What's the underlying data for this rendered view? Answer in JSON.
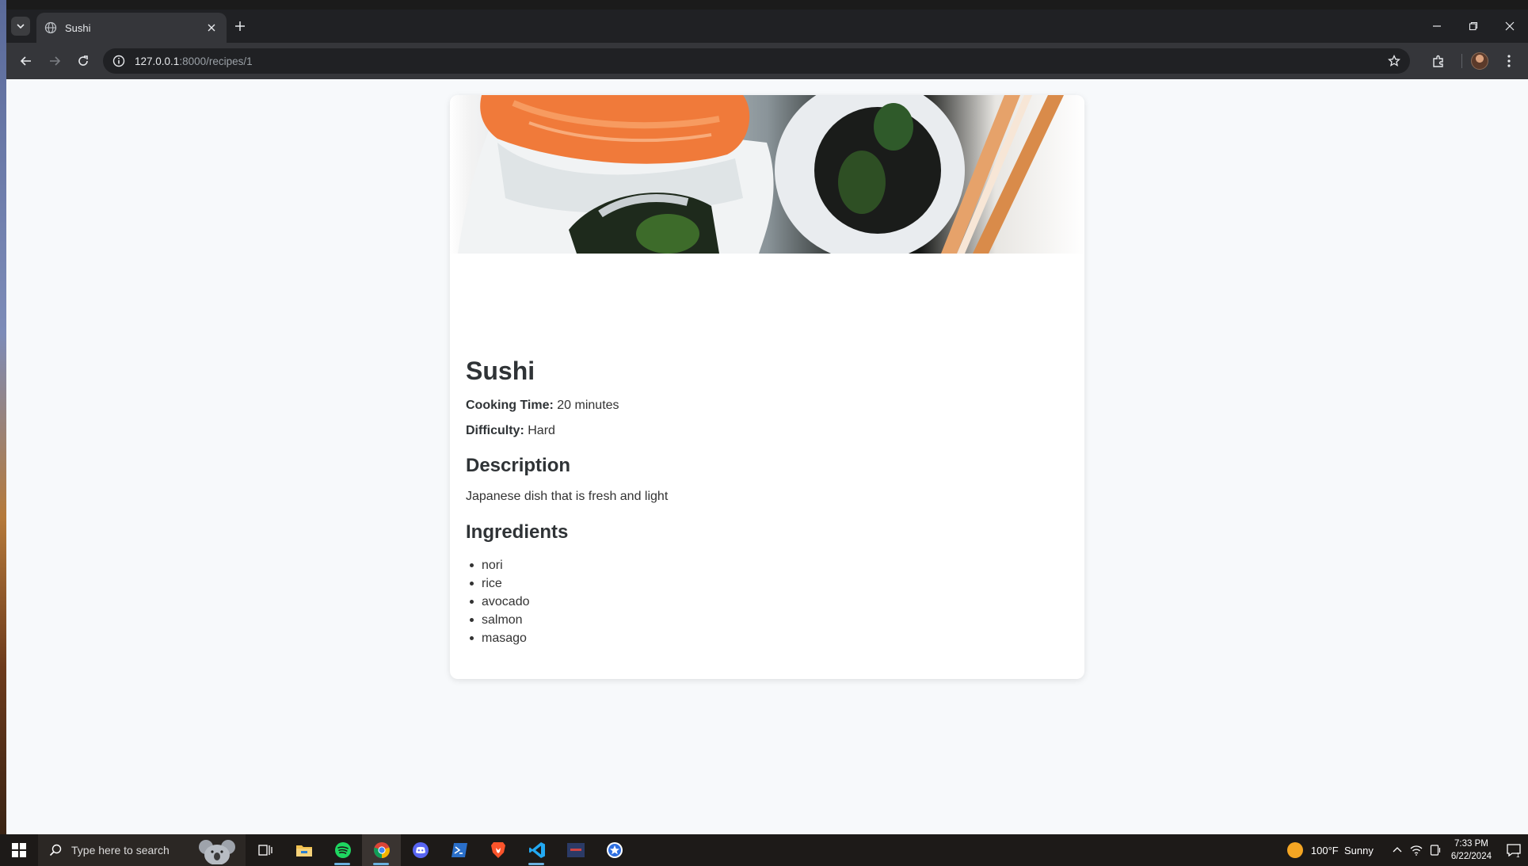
{
  "browser": {
    "tab_title": "Sushi",
    "url_host": "127.0.0.1",
    "url_rest": ":8000/recipes/1"
  },
  "recipe": {
    "title": "Sushi",
    "cooking_time_label": "Cooking Time:",
    "cooking_time_value": "20 minutes",
    "difficulty_label": "Difficulty:",
    "difficulty_value": "Hard",
    "description_heading": "Description",
    "description": "Japanese dish that is fresh and light",
    "ingredients_heading": "Ingredients",
    "ingredients": [
      "nori",
      "rice",
      "avocado",
      "salmon",
      "masago"
    ]
  },
  "taskbar": {
    "search_placeholder": "Type here to search",
    "weather_temp": "100°F",
    "weather_text": "Sunny",
    "time": "7:33 PM",
    "date": "6/22/2024",
    "notification_count": "1"
  },
  "colors": {
    "page_bg": "#f7f9fb",
    "card_bg": "#ffffff",
    "text": "#2f3336",
    "salmon": "#f07a3a"
  }
}
